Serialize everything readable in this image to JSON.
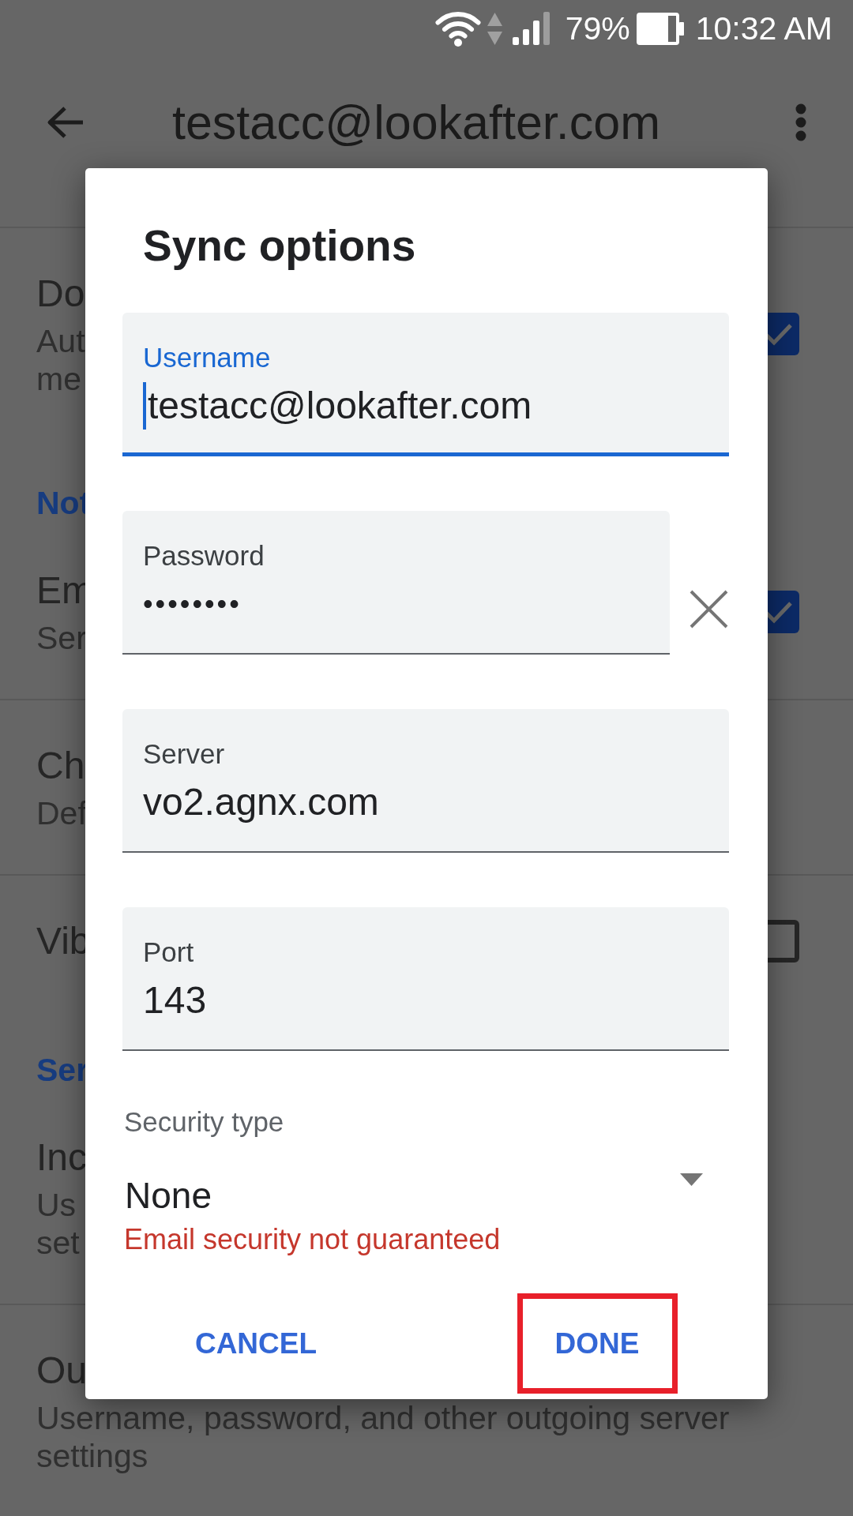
{
  "status_bar": {
    "battery": "79%",
    "time": "10:32 AM"
  },
  "app_bar": {
    "title": "testacc@lookafter.com"
  },
  "settings": [
    {
      "kind": "item",
      "title": "Do",
      "summary": [
        "Aut",
        "me"
      ],
      "checked": true,
      "divider_below": false
    },
    {
      "kind": "category",
      "title": "Not",
      "divider_below": false
    },
    {
      "kind": "item",
      "title": "Em",
      "summary": [
        "Ser"
      ],
      "checked": true,
      "divider_below": true
    },
    {
      "kind": "item",
      "title": "Ch",
      "summary": [
        "Def"
      ],
      "divider_below": true
    },
    {
      "kind": "item",
      "title": "Vib",
      "checked": false,
      "divider_below": false
    },
    {
      "kind": "category",
      "title": "Ser",
      "divider_below": false
    },
    {
      "kind": "item",
      "title": "Inc",
      "summary": [
        "Us",
        "set"
      ],
      "divider_below": true
    },
    {
      "kind": "item",
      "title": "Ou",
      "summary": [
        "Username, password, and other outgoing server",
        "settings"
      ],
      "divider_below": false
    }
  ],
  "dialog": {
    "title": "Sync options",
    "fields": [
      {
        "kind": "text",
        "label": "Username",
        "value": "testacc@lookafter.com",
        "focused": true,
        "clear_button": false
      },
      {
        "kind": "password",
        "label": "Password",
        "value": "••••••••",
        "focused": false,
        "clear_button": true
      },
      {
        "kind": "text",
        "label": "Server",
        "value": "vo2.agnx.com",
        "focused": false,
        "clear_button": false
      },
      {
        "kind": "text",
        "label": "Port",
        "value": "143",
        "focused": false,
        "clear_button": false
      }
    ],
    "security": {
      "label": "Security type",
      "value": "None",
      "error": "Email security not guaranteed"
    },
    "buttons": [
      {
        "label": "CANCEL",
        "highlighted": false
      },
      {
        "label": "DONE",
        "highlighted": true
      }
    ]
  }
}
